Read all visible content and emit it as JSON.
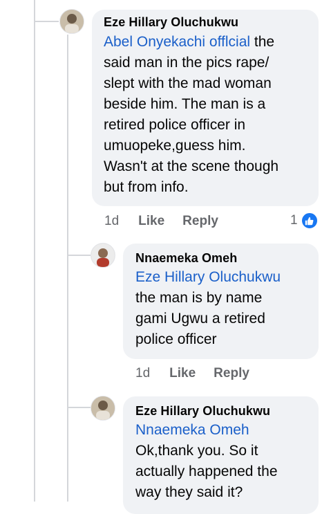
{
  "comments": [
    {
      "author": "Eze Hillary Oluchukwu",
      "mention": "Abel Onyekachi offlcial",
      "lines": [
        " the",
        "said man in the pics rape/",
        "slept with the mad woman",
        "beside him. The man is a",
        "retired police officer in",
        "umuopeke,guess him.",
        "Wasn't at the scene though",
        "but from info."
      ],
      "time": "1d",
      "like_label": "Like",
      "reply_label": "Reply",
      "reaction_count": "1",
      "reaction_icon": "like-icon"
    },
    {
      "author": "Nnaemeka Omeh",
      "mention": "Eze Hillary Oluchukwu",
      "lines": [
        "the man is by name",
        "gami Ugwu  a retired",
        "police officer"
      ],
      "time": "1d",
      "like_label": "Like",
      "reply_label": "Reply"
    },
    {
      "author": "Eze Hillary Oluchukwu",
      "mention": "Nnaemeka Omeh",
      "lines": [
        "Ok,thank you. So it",
        "actually happened the",
        "way they said it?"
      ]
    }
  ],
  "colors": {
    "bubble": "#f0f2f5",
    "mention": "#1a5fc9",
    "meta": "#65676b",
    "like_blue": "#1877f2"
  }
}
